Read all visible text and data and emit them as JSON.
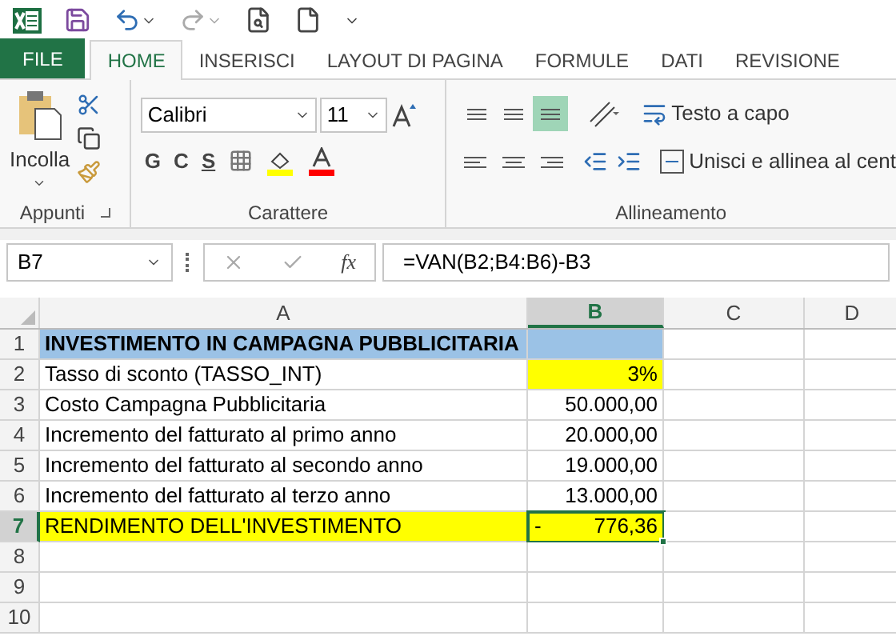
{
  "tabs": [
    {
      "label": "FILE",
      "kind": "file",
      "selected": false
    },
    {
      "label": "HOME",
      "kind": "tab",
      "selected": true
    },
    {
      "label": "INSERISCI",
      "kind": "tab",
      "selected": false
    },
    {
      "label": "LAYOUT DI PAGINA",
      "kind": "tab",
      "selected": false
    },
    {
      "label": "FORMULE",
      "kind": "tab",
      "selected": false
    },
    {
      "label": "DATI",
      "kind": "tab",
      "selected": false
    },
    {
      "label": "REVISIONE",
      "kind": "tab",
      "selected": false
    }
  ],
  "ribbon": {
    "clipboard": {
      "title": "Appunti",
      "paste_label": "Incolla"
    },
    "font": {
      "title": "Carattere",
      "font_name": "Calibri",
      "font_size": "11",
      "bold": "G",
      "italic": "C",
      "underline": "S"
    },
    "alignment": {
      "title": "Allineamento",
      "vertical": [
        {
          "selected": false
        },
        {
          "selected": false
        },
        {
          "selected": true
        }
      ],
      "wrap_text": "Testo a capo",
      "merge_center": "Unisci e allinea al cent"
    }
  },
  "formula_bar": {
    "name_box": "B7",
    "fx": "fx",
    "formula": "=VAN(B2;B4:B6)-B3"
  },
  "sheet": {
    "columns": [
      {
        "label": "A",
        "selected": false
      },
      {
        "label": "B",
        "selected": true
      },
      {
        "label": "C",
        "selected": false
      },
      {
        "label": "D",
        "selected": false
      }
    ],
    "rows": [
      {
        "number": "1",
        "selected": false,
        "a": {
          "text": "INVESTIMENTO IN CAMPAGNA PUBBLICITARIA",
          "bold": true,
          "color": "#9bc2e6"
        },
        "b": {
          "color": "#9bc2e6",
          "active": false
        }
      },
      {
        "number": "2",
        "selected": false,
        "a": {
          "text": "Tasso di sconto (TASSO_INT)",
          "bold": false
        },
        "b": {
          "value": "3%",
          "color": "#ffff00",
          "active": false
        }
      },
      {
        "number": "3",
        "selected": false,
        "a": {
          "text": "Costo Campagna Pubblicitaria",
          "bold": false
        },
        "b": {
          "value": "50.000,00",
          "active": false
        }
      },
      {
        "number": "4",
        "selected": false,
        "a": {
          "text": "Incremento del fatturato al primo anno",
          "bold": false
        },
        "b": {
          "value": "20.000,00",
          "active": false
        }
      },
      {
        "number": "5",
        "selected": false,
        "a": {
          "text": "Incremento del fatturato al secondo anno",
          "bold": false
        },
        "b": {
          "value": "19.000,00",
          "active": false
        }
      },
      {
        "number": "6",
        "selected": false,
        "a": {
          "text": "Incremento del fatturato al terzo anno",
          "bold": false
        },
        "b": {
          "value": "13.000,00",
          "active": false
        }
      },
      {
        "number": "7",
        "selected": true,
        "a": {
          "text": "RENDIMENTO DELL'INVESTIMENTO",
          "bold": false,
          "color": "#ffff00"
        },
        "b": {
          "sign": "-",
          "value": "776,36",
          "color": "#ffff00",
          "active": true
        }
      },
      {
        "number": "8",
        "selected": false
      },
      {
        "number": "9",
        "selected": false
      },
      {
        "number": "10",
        "selected": false
      }
    ]
  }
}
